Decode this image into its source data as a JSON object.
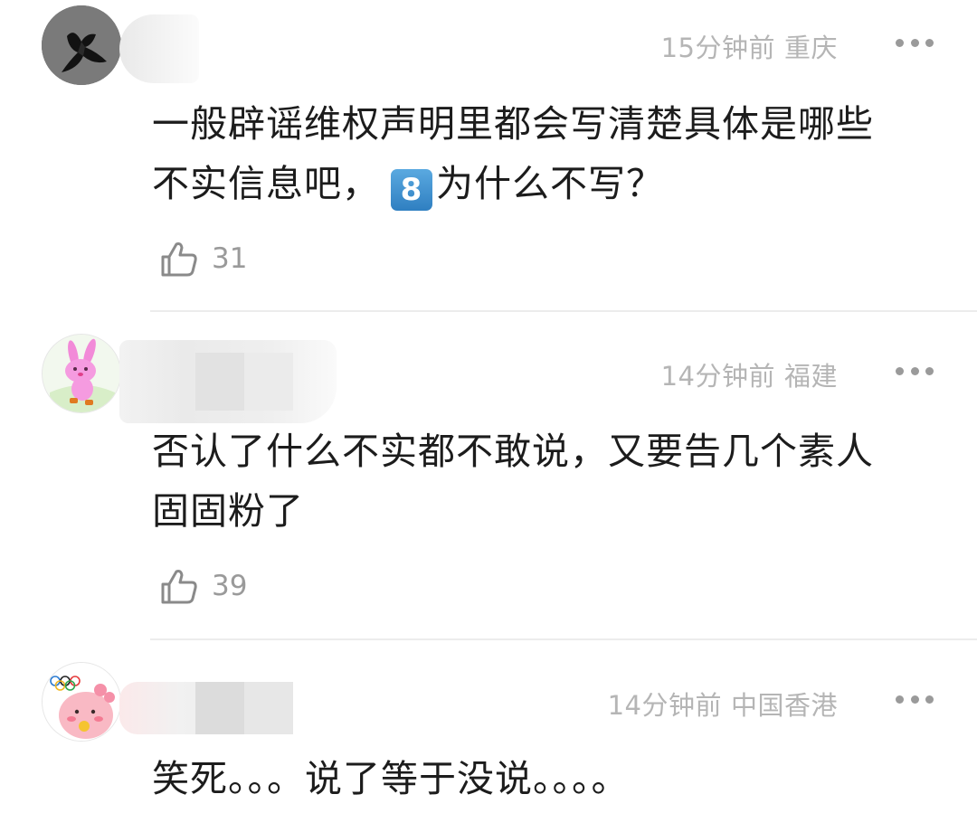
{
  "comments": [
    {
      "time": "15分钟前",
      "location": "重庆",
      "text_lines": [
        "一般辟谣维权声明里都会写清楚具体是哪些",
        "不实信息吧，",
        "为什么不写？"
      ],
      "emoji": "8",
      "likes": "31",
      "avatar_icon": "black-butterfly-avatar"
    },
    {
      "time": "14分钟前",
      "location": "福建",
      "text_lines": [
        "否认了什么不实都不敢说，又要告几个素人",
        "固固粉了"
      ],
      "likes": "39",
      "avatar_icon": "pink-rabbit-avatar"
    },
    {
      "time": "14分钟前",
      "location": "中国香港",
      "text_lines": [
        "笑死。。。说了等于没说。。。。"
      ],
      "avatar_icon": "pink-cartoon-olympic-avatar"
    }
  ],
  "icons": {
    "like": "thumbs-up-icon",
    "more": "more-dots-icon"
  },
  "colors": {
    "meta_text": "#b5b5b5",
    "body_text": "#1c1c1c",
    "like_icon": "#8a8a8a",
    "divider": "#ececec"
  }
}
